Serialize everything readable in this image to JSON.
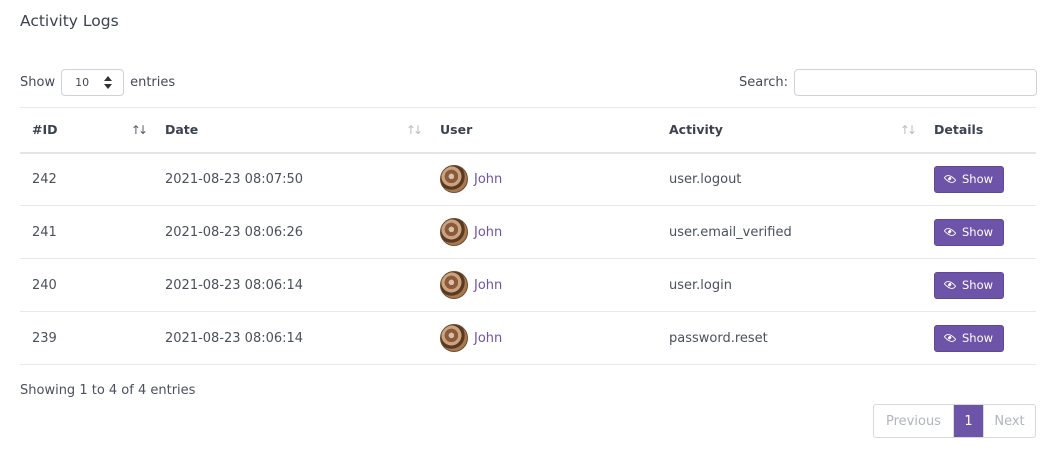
{
  "page": {
    "title": "Activity Logs"
  },
  "length": {
    "show_label": "Show",
    "selected": "10",
    "entries_label": "entries"
  },
  "search": {
    "label": "Search:",
    "value": "",
    "placeholder": ""
  },
  "table": {
    "columns": [
      "#ID",
      "Date",
      "User",
      "Activity",
      "Details"
    ],
    "rows": [
      {
        "id": "242",
        "date": "2021-08-23 08:07:50",
        "user": "John",
        "activity": "user.logout",
        "details": "Show"
      },
      {
        "id": "241",
        "date": "2021-08-23 08:06:26",
        "user": "John",
        "activity": "user.email_verified",
        "details": "Show"
      },
      {
        "id": "240",
        "date": "2021-08-23 08:06:14",
        "user": "John",
        "activity": "user.login",
        "details": "Show"
      },
      {
        "id": "239",
        "date": "2021-08-23 08:06:14",
        "user": "John",
        "activity": "password.reset",
        "details": "Show"
      }
    ]
  },
  "footer": {
    "info": "Showing 1 to 4 of 4 entries"
  },
  "pagination": {
    "previous": "Previous",
    "current": "1",
    "next": "Next"
  },
  "icons": {
    "sort": "sort-arrows-icon",
    "eye": "eye-icon",
    "select_arrows": "select-arrows-icon"
  },
  "colors": {
    "accent": "#6e54a8",
    "text": "#444a55",
    "border": "#e6e8ec"
  }
}
